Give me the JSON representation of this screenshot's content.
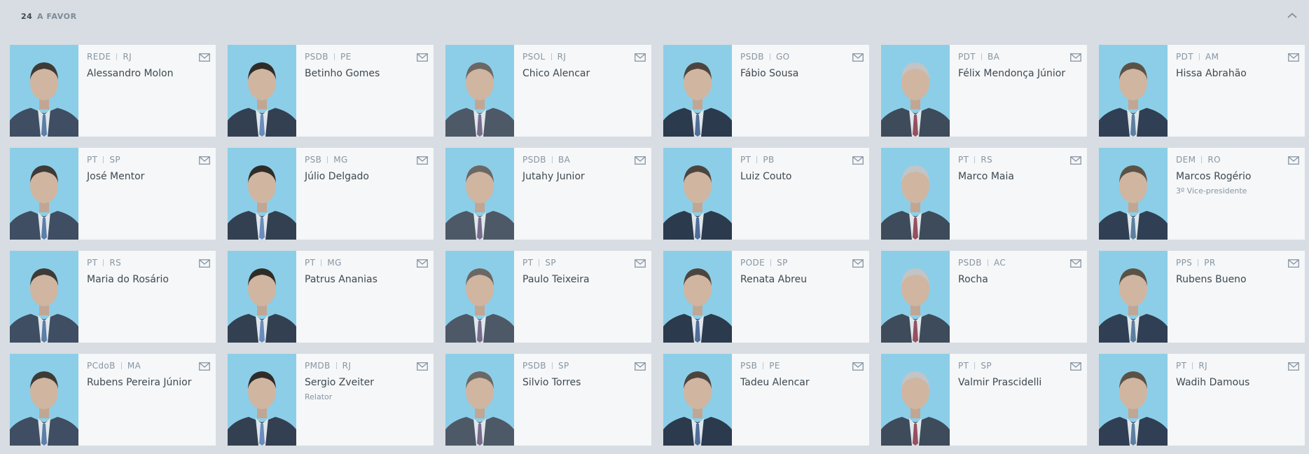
{
  "header": {
    "count": "24",
    "label": "A FAVOR"
  },
  "colors": {
    "page_bg": "#dfe3e8",
    "card_bg": "#ffffff",
    "photo_bg": "#8fd3ee",
    "text_primary": "#3b444d",
    "text_muted": "#8a96a3"
  },
  "members": [
    {
      "party": "REDE",
      "state": "RJ",
      "name": "Alessandro Molon",
      "role": ""
    },
    {
      "party": "PSDB",
      "state": "PE",
      "name": "Betinho Gomes",
      "role": ""
    },
    {
      "party": "PSOL",
      "state": "RJ",
      "name": "Chico Alencar",
      "role": ""
    },
    {
      "party": "PSDB",
      "state": "GO",
      "name": "Fábio Sousa",
      "role": ""
    },
    {
      "party": "PDT",
      "state": "BA",
      "name": "Félix Mendonça Júnior",
      "role": ""
    },
    {
      "party": "PDT",
      "state": "AM",
      "name": "Hissa Abrahão",
      "role": ""
    },
    {
      "party": "PT",
      "state": "SP",
      "name": "José Mentor",
      "role": ""
    },
    {
      "party": "PSB",
      "state": "MG",
      "name": "Júlio Delgado",
      "role": ""
    },
    {
      "party": "PSDB",
      "state": "BA",
      "name": "Jutahy Junior",
      "role": ""
    },
    {
      "party": "PT",
      "state": "PB",
      "name": "Luiz Couto",
      "role": ""
    },
    {
      "party": "PT",
      "state": "RS",
      "name": "Marco Maia",
      "role": ""
    },
    {
      "party": "DEM",
      "state": "RO",
      "name": "Marcos Rogério",
      "role": "3º Vice-presidente"
    },
    {
      "party": "PT",
      "state": "RS",
      "name": "Maria do Rosário",
      "role": ""
    },
    {
      "party": "PT",
      "state": "MG",
      "name": "Patrus Ananias",
      "role": ""
    },
    {
      "party": "PT",
      "state": "SP",
      "name": "Paulo Teixeira",
      "role": ""
    },
    {
      "party": "PODE",
      "state": "SP",
      "name": "Renata Abreu",
      "role": ""
    },
    {
      "party": "PSDB",
      "state": "AC",
      "name": "Rocha",
      "role": ""
    },
    {
      "party": "PPS",
      "state": "PR",
      "name": "Rubens Bueno",
      "role": ""
    },
    {
      "party": "PCdoB",
      "state": "MA",
      "name": "Rubens Pereira Júnior",
      "role": ""
    },
    {
      "party": "PMDB",
      "state": "RJ",
      "name": "Sergio Zveiter",
      "role": "Relator"
    },
    {
      "party": "PSDB",
      "state": "SP",
      "name": "Silvio Torres",
      "role": ""
    },
    {
      "party": "PSB",
      "state": "PE",
      "name": "Tadeu Alencar",
      "role": ""
    },
    {
      "party": "PT",
      "state": "SP",
      "name": "Valmir Prascidelli",
      "role": ""
    },
    {
      "party": "PT",
      "state": "RJ",
      "name": "Wadih Damous",
      "role": ""
    }
  ]
}
